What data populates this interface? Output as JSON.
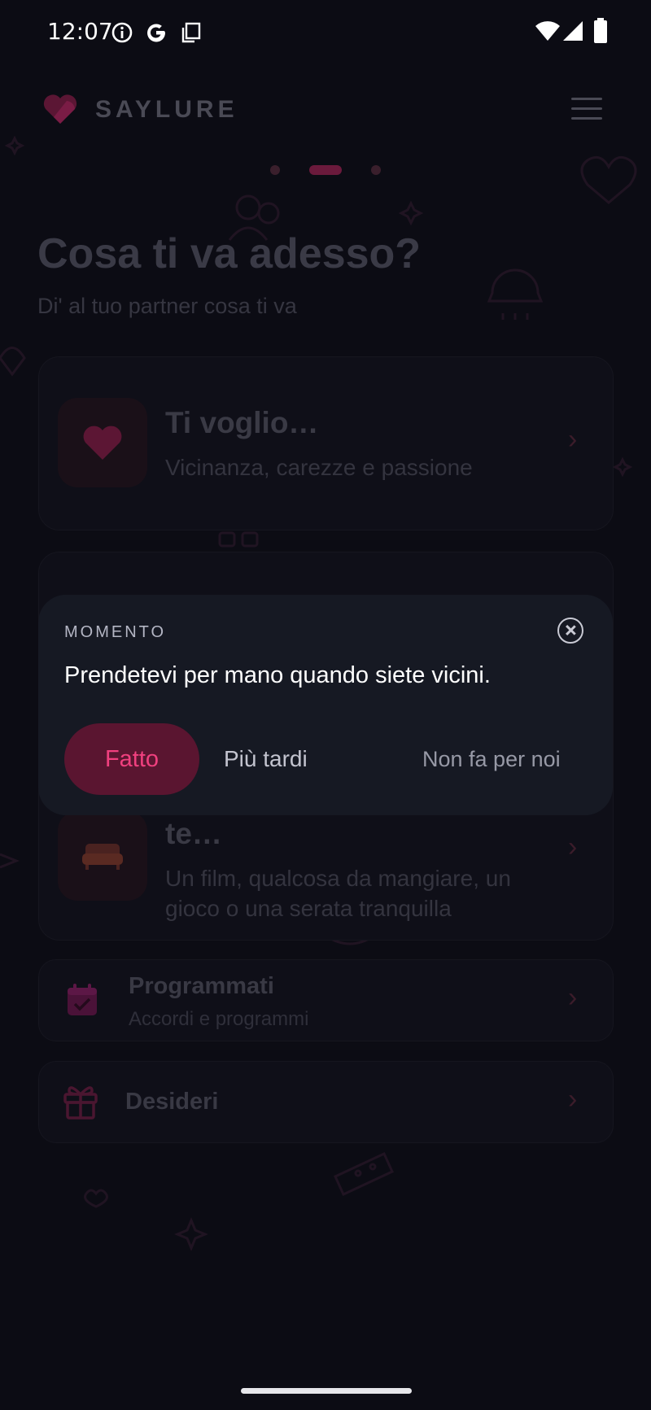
{
  "status_bar": {
    "time": "12:07",
    "left_icons": [
      "info-icon",
      "google-icon",
      "screenshot-icon"
    ],
    "right_icons": [
      "wifi-icon",
      "signal-icon",
      "battery-icon"
    ]
  },
  "header": {
    "brand": "SAYLURE",
    "logo_icon": "heart-logo-icon",
    "menu_icon": "hamburger-menu-icon"
  },
  "pager": {
    "count": 3,
    "active": 2
  },
  "page": {
    "title": "Cosa ti va adesso?",
    "subtitle": "Di' al tuo partner cosa ti va"
  },
  "cards": [
    {
      "icon": "heart-icon",
      "title": "Ti voglio…",
      "description": "Vicinanza, carezze e passione"
    },
    {
      "icon": "sofa-icon",
      "title": "te…",
      "description": "Un film, qualcosa da mangiare, un gioco o una serata tranquilla"
    }
  ],
  "rows": [
    {
      "icon": "calendar-check-icon",
      "title": "Programmati",
      "subtitle": "Accordi e programmi"
    },
    {
      "icon": "gift-icon",
      "title": "Desideri",
      "subtitle": ""
    }
  ],
  "popup": {
    "label": "MOMENTO",
    "message": "Prendetevi per mano quando siete vicini.",
    "done_label": "Fatto",
    "later_label": "Più tardi",
    "decline_label": "Non fa per noi",
    "close_icon": "close-circle-icon"
  },
  "colors": {
    "accent": "#f0407f",
    "accent_bg": "#5a1530",
    "popup_bg": "#161923",
    "background": "#0c0c14"
  }
}
